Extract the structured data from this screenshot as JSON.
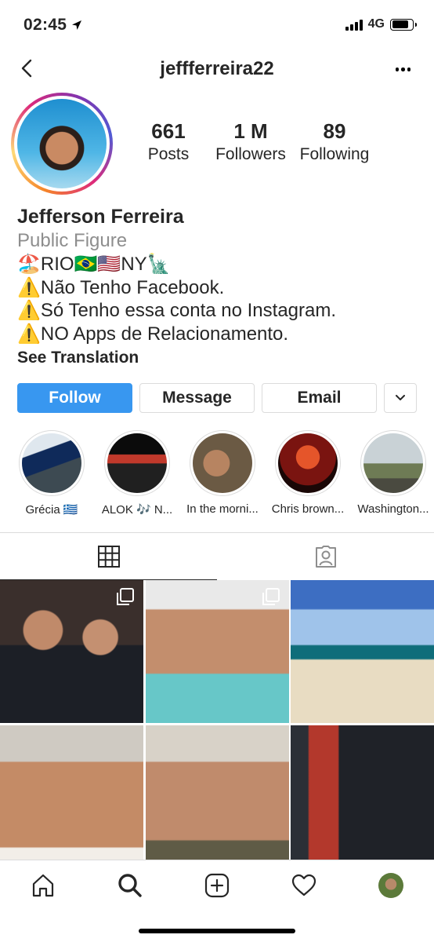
{
  "status": {
    "time": "02:45",
    "network": "4G"
  },
  "header": {
    "username": "jeffferreira22"
  },
  "profile": {
    "stats": [
      {
        "value": "661",
        "label": "Posts"
      },
      {
        "value": "1 M",
        "label": "Followers"
      },
      {
        "value": "89",
        "label": "Following"
      }
    ],
    "name": "Jefferson Ferreira",
    "category": "Public Figure",
    "bio_lines": [
      "🏖️RIO🇧🇷🇺🇸NY🗽",
      "⚠️Não Tenho Facebook.",
      "⚠️Só Tenho essa conta no Instagram.",
      "⚠️NO Apps de Relacionamento."
    ],
    "see_translation": "See Translation"
  },
  "actions": {
    "follow": "Follow",
    "message": "Message",
    "email": "Email"
  },
  "highlights": [
    {
      "label": "Grécia 🇬🇷",
      "color": "#5b6d7a"
    },
    {
      "label": "ALOK 🎶 N...",
      "color": "#1b1b1b"
    },
    {
      "label": "In the morni...",
      "color": "#8a6a3e"
    },
    {
      "label": "Chris brown...",
      "color": "#9c2415"
    },
    {
      "label": "Washington...",
      "color": "#8fa0a6"
    }
  ],
  "colors": {
    "accent": "#3897f0",
    "border": "#dbdbdb",
    "muted": "#8e8e8e"
  }
}
